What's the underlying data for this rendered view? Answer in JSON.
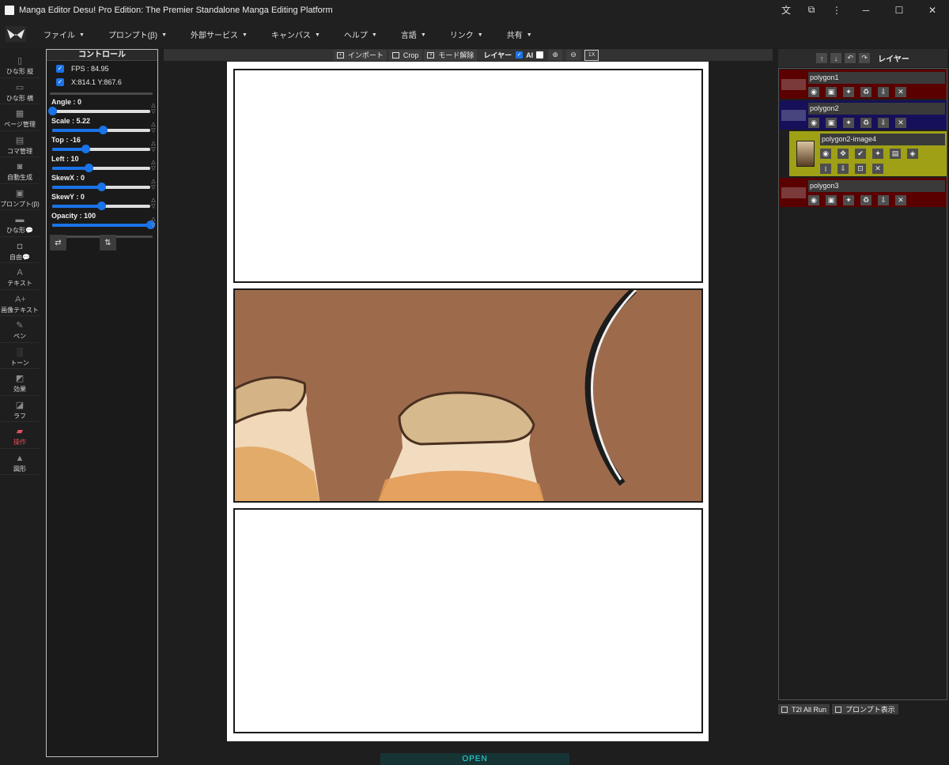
{
  "window": {
    "title": "Manga Editor Desu! Pro Edition: The Premier Standalone Manga Editing Platform",
    "controls": [
      "translate-icon",
      "extension-icon",
      "more-icon",
      "minimize-icon",
      "maximize-icon",
      "close-icon"
    ]
  },
  "menu": {
    "items": [
      "ファイル",
      "プロンプト(β)",
      "外部サービス",
      "キャンバス",
      "ヘルプ",
      "言語",
      "リンク",
      "共有"
    ]
  },
  "tools": [
    {
      "label": "ひな形 縦",
      "icon": "portrait-frame-icon"
    },
    {
      "label": "ひな形 横",
      "icon": "landscape-frame-icon"
    },
    {
      "label": "ページ管理",
      "icon": "grid-icon"
    },
    {
      "label": "コマ管理",
      "icon": "panels-icon"
    },
    {
      "label": "自動生成",
      "icon": "robot-icon"
    },
    {
      "label": "プロンプト(β)",
      "icon": "document-icon"
    },
    {
      "label": "ひな形💬",
      "icon": "speech-bubble-icon"
    },
    {
      "label": "自由💬",
      "icon": "add-bubble-icon"
    },
    {
      "label": "テキスト",
      "icon": "text-icon"
    },
    {
      "label": "画像テキスト",
      "icon": "image-text-icon"
    },
    {
      "label": "ペン",
      "icon": "pen-icon"
    },
    {
      "label": "トーン",
      "icon": "tone-icon"
    },
    {
      "label": "効果",
      "icon": "effect-icon"
    },
    {
      "label": "ラフ",
      "icon": "rough-icon"
    },
    {
      "label": "操作",
      "icon": "gamepad-icon",
      "active": true
    },
    {
      "label": "図形",
      "icon": "shapes-icon"
    }
  ],
  "controls": {
    "title": "コントロール",
    "fps": "FPS : 84.95",
    "coords": "X:814.1 Y:867.6",
    "sliders": [
      {
        "label": "Angle : 0",
        "fraction": 0.0
      },
      {
        "label": "Scale : 5.22",
        "fraction": 0.52
      },
      {
        "label": "Top : -16",
        "fraction": 0.34
      },
      {
        "label": "Left : 10",
        "fraction": 0.37
      },
      {
        "label": "SkewX : 0",
        "fraction": 0.5
      },
      {
        "label": "SkewY : 0",
        "fraction": 0.5
      },
      {
        "label": "Opacity : 100",
        "fraction": 1.0
      }
    ],
    "flip_h": "⇄",
    "flip_v": "⇅"
  },
  "canvas_toolbar": {
    "import": "インポート",
    "crop": "Crop",
    "mode_off": "モード解除",
    "layer": "レイヤー",
    "ai": "AI",
    "zoom_in": "⊕",
    "zoom_out": "⊖",
    "reset": "1X"
  },
  "layers": {
    "title": "レイヤー",
    "items": [
      {
        "name": "polygon1",
        "color": "#5a0000"
      },
      {
        "name": "polygon2",
        "color": "#16105a"
      },
      {
        "name": "polygon2-image4",
        "color": "#9fa015"
      },
      {
        "name": "polygon3",
        "color": "#5a0000"
      }
    ]
  },
  "bottom": {
    "t2i": "T2I All Run",
    "prompt_show": "プロンプト表示"
  },
  "status": {
    "open": "OPEN"
  }
}
